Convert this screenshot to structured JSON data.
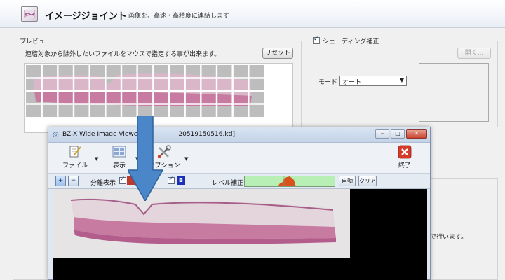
{
  "app": {
    "title": "イメージジョイント",
    "subtitle": "画像を、高速・高精度に連結します"
  },
  "preview": {
    "label": "プレビュー",
    "hint": "連結対象から除外したいファイルをマウスで指定する事が出来ます。",
    "reset_label": "リセット"
  },
  "shading": {
    "checkbox_label": "シェーディング補正",
    "checked": true,
    "open_label": "開く...",
    "mode_label": "モード",
    "mode_value": "オート"
  },
  "partial_text": "動で行います。",
  "viewer": {
    "title": "BZ-X Wide Image Viewer - [",
    "title_suffix": "20519150516.ktl]",
    "toolbar": {
      "file_label": "ファイル",
      "view_label": "表示",
      "options_label": "オプション",
      "exit_label": "終了"
    },
    "subbar": {
      "separate_display_label": "分離表示",
      "channel_b_label": "B",
      "level_label": "レベル補正",
      "auto_label": "自動",
      "clear_label": "クリア"
    }
  },
  "colors": {
    "arrow": "#4a86c8",
    "tissue_pink": "#c77ba0",
    "level_green": "#b7efb5",
    "level_peak": "#d9521a",
    "channel_b": "#1b2fb8"
  }
}
